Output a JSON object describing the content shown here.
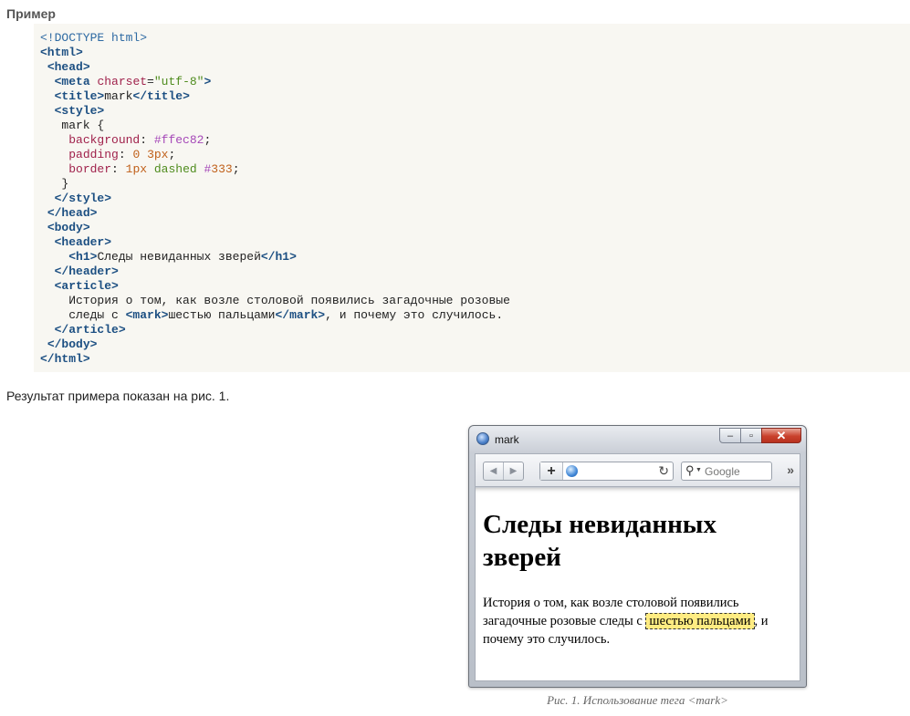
{
  "section": {
    "heading": "Пример"
  },
  "code": {
    "lines": [
      "<!DOCTYPE html>",
      "<html>",
      " <head>",
      "  <meta charset=\"utf-8\">",
      "  <title>mark</title>",
      "  <style>",
      "   mark {",
      "    background: #ffec82;",
      "    padding: 0 3px;",
      "    border: 1px dashed #333;",
      "   }",
      "  </style>",
      " </head>",
      " <body>",
      "  <header>",
      "    <h1>Следы невиданных зверей</h1>",
      "  </header>",
      "  <article>",
      "    История о том, как возле столовой появились загадочные розовые",
      "    следы с <mark>шестью пальцами</mark>, и почему это случилось.",
      "  </article>",
      " </body>",
      "</html>"
    ]
  },
  "result_text": "Результат примера показан на рис. 1.",
  "browser": {
    "title": "mark",
    "controls": {
      "minimize": "‒",
      "maximize": "▫",
      "close": "✕"
    },
    "toolbar": {
      "back": "◀",
      "forward": "▶",
      "add": "+",
      "reload": "↻",
      "search_placeholder": "Google",
      "overflow": "»"
    },
    "page": {
      "h1": "Следы невиданных зверей",
      "p_before": "История о том, как возле столовой появились загадочные розовые следы с ",
      "p_mark": "шестью пальцами",
      "p_after": ", и почему это случилось."
    }
  },
  "caption": "Рис. 1. Использование тега <mark>",
  "colors": {
    "mark_bg": "#ffec82",
    "code_bg": "#f8f7f2"
  }
}
